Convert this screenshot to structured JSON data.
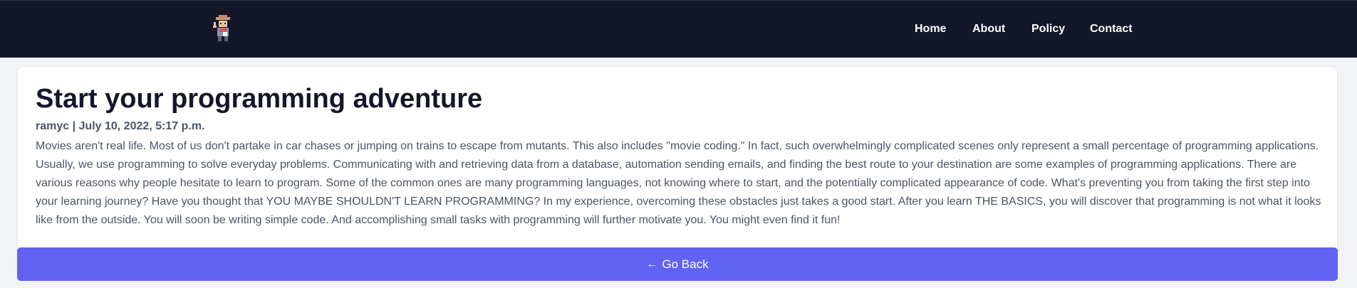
{
  "nav": {
    "logo_icon": "cowboy-avatar-icon",
    "links": [
      {
        "label": "Home"
      },
      {
        "label": "About"
      },
      {
        "label": "Policy"
      },
      {
        "label": "Contact"
      }
    ]
  },
  "post": {
    "title": "Start your programming adventure",
    "meta": "ramyc | July 10, 2022, 5:17 p.m.",
    "body": "Movies aren't real life. Most of us don't partake in car chases or jumping on trains to escape from mutants. This also includes \"movie coding.\" In fact, such overwhelmingly complicated scenes only represent a small percentage of programming applications. Usually, we use programming to solve everyday problems. Communicating with and retrieving data from a database, automation sending emails, and finding the best route to your destination are some examples of programming applications. There are various reasons why people hesitate to learn to program. Some of the common ones are many programming languages, not knowing where to start, and the potentially complicated appearance of code. What's preventing you from taking the first step into your learning journey? Have you thought that YOU MAYBE SHOULDN'T LEARN PROGRAMMING? In my experience, overcoming these obstacles just takes a good start. After you learn THE BASICS, you will discover that programming is not what it looks like from the outside. You will soon be writing simple code. And accomplishing small tasks with programming will further motivate you. You might even find it fun!"
  },
  "back_button": {
    "icon": "arrow-left-icon",
    "label": "Go Back"
  },
  "colors": {
    "navbar": "#141629",
    "accent": "#6062f2",
    "background": "#f1f3f6"
  }
}
